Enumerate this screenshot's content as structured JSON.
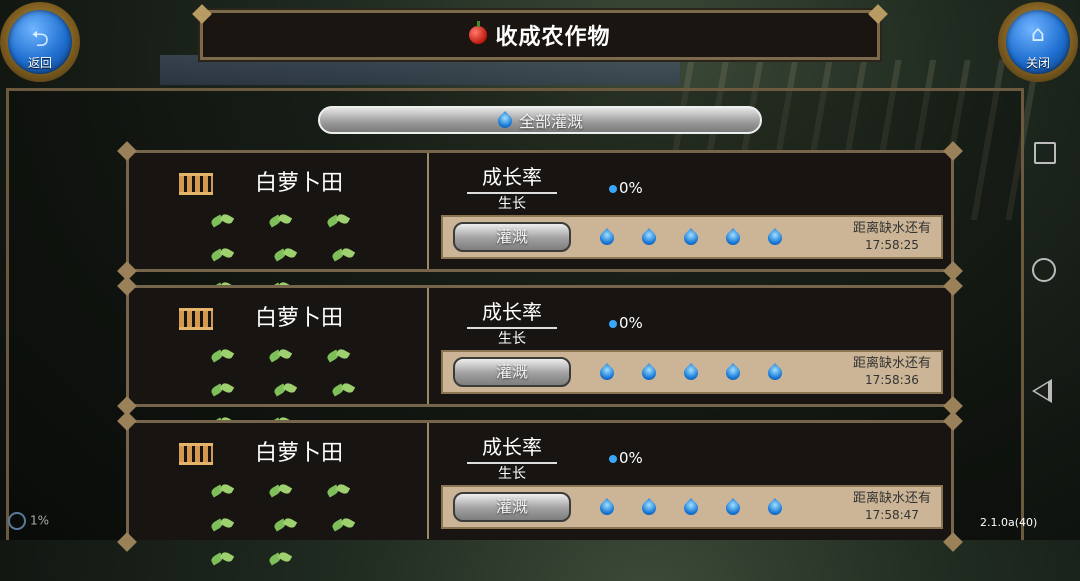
{
  "title": "收成农作物",
  "back_button": {
    "label": "返回",
    "icon": "back-arrow-icon"
  },
  "close_button": {
    "label": "关闭",
    "icon": "home-icon"
  },
  "water_all_label": "全部灌溉",
  "plots": [
    {
      "name": "白萝卜田",
      "rate_label": "成长率",
      "growth_label": "生长",
      "rate_value": "0%",
      "water_label": "灌溉",
      "countdown_label": "距离缺水还有",
      "countdown_time": "17:58:25",
      "drops": 5
    },
    {
      "name": "白萝卜田",
      "rate_label": "成长率",
      "growth_label": "生长",
      "rate_value": "0%",
      "water_label": "灌溉",
      "countdown_label": "距离缺水还有",
      "countdown_time": "17:58:36",
      "drops": 5
    },
    {
      "name": "白萝卜田",
      "rate_label": "成长率",
      "growth_label": "生长",
      "rate_value": "0%",
      "water_label": "灌溉",
      "countdown_label": "距离缺水还有",
      "countdown_time": "17:58:47",
      "drops": 5
    }
  ],
  "status": {
    "loading": "1%",
    "version": "2.1.0a(40)"
  },
  "colors": {
    "drop": "#1a7ad8",
    "panel_border": "#76654a",
    "water_bar": "#cbb596"
  }
}
